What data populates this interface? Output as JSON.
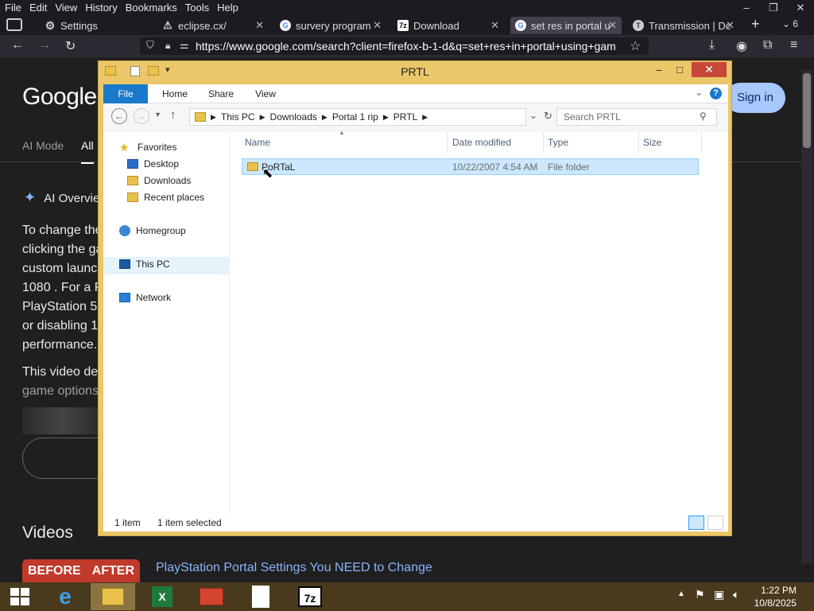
{
  "browser": {
    "menu": [
      "File",
      "Edit",
      "View",
      "History",
      "Bookmarks",
      "Tools",
      "Help"
    ],
    "window_controls": [
      "–",
      "❐",
      "✕"
    ],
    "tabs": [
      {
        "label": "Settings",
        "icon": "gear-icon",
        "close": ""
      },
      {
        "label": "eclipse.cx/",
        "icon": "warning-icon",
        "close": "✕"
      },
      {
        "label": "survery program",
        "icon": "google-icon",
        "close": "✕"
      },
      {
        "label": "Download",
        "icon": "7zip-icon",
        "close": "✕"
      },
      {
        "label": "set res in portal u",
        "icon": "google-icon",
        "close": "✕",
        "active": true
      },
      {
        "label": "Transmission | Dc",
        "icon": "transmission-icon",
        "close": "✕"
      }
    ],
    "new_tab": "+",
    "tab_overflow_count": "6",
    "url": "https://www.google.com/search?client=firefox-b-1-d&q=set+res+in+portal+using+gam"
  },
  "google": {
    "logo": "Google",
    "sign_in": "Sign in",
    "tabs": [
      "AI Mode",
      "All"
    ],
    "ai_overview": "AI Overvie",
    "text_lines": [
      "To change the",
      "clicking the ga",
      "custom launc",
      "1080 . For a P",
      "PlayStation 5",
      "or disabling 1",
      "performance."
    ],
    "text2_lines": [
      "This video de",
      "game options"
    ],
    "videos_heading": "Videos",
    "video_thumb": {
      "left": "BEFORE",
      "right": "AFTER"
    },
    "video_title": "PlayStation Portal Settings You NEED to Change"
  },
  "explorer": {
    "title": "PRTL",
    "ribbon_tabs": [
      "File",
      "Home",
      "Share",
      "View"
    ],
    "breadcrumb": [
      "This PC",
      "Downloads",
      "Portal 1 rip",
      "PRTL"
    ],
    "search_placeholder": "Search PRTL",
    "nav": {
      "favorites": "Favorites",
      "desktop": "Desktop",
      "downloads": "Downloads",
      "recent": "Recent places",
      "homegroup": "Homegroup",
      "this_pc": "This PC",
      "network": "Network"
    },
    "columns": {
      "name": "Name",
      "date": "Date modified",
      "type": "Type",
      "size": "Size"
    },
    "files": [
      {
        "name": "PoRTaL",
        "date": "10/22/2007 4:54 AM",
        "type": "File folder",
        "size": ""
      }
    ],
    "status": {
      "count": "1 item",
      "selected": "1 item selected"
    }
  },
  "taskbar": {
    "time": "1:22 PM",
    "date": "10/8/2025"
  },
  "colors": {
    "explorer_frame": "#ebc769",
    "selection": "#cce8ff",
    "taskbar": "#4a3a1d",
    "ribbon_file": "#1979ca"
  }
}
